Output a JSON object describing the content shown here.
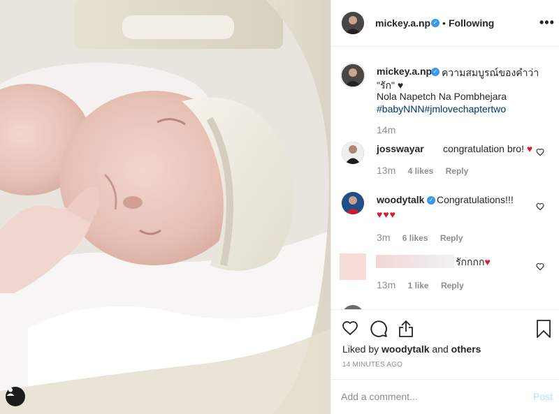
{
  "post": {
    "username": "mickey.a.np",
    "follow_status": "Following",
    "more_label": "•••",
    "separator": "•"
  },
  "caption": {
    "username": "mickey.a.np",
    "line1": "ความสมบูรณ์ของคำว่า",
    "line2": "\"รัก\" ♥",
    "line3": "Nola Napetch Na Pombhejara",
    "hashtags": "#babyNNN#jmlovechaptertwo",
    "time": "14m"
  },
  "comments": [
    {
      "username": "josswayar",
      "text": "congratulation bro!",
      "emoji": "♥",
      "time": "13m",
      "likes": "4 likes",
      "reply": "Reply",
      "verified": false
    },
    {
      "username": "woodytalk",
      "text": "Congratulations!!!",
      "emoji": "♥♥♥",
      "time": "3m",
      "likes": "6 likes",
      "reply": "Reply",
      "verified": true
    },
    {
      "username": "",
      "text": "รักกกก",
      "emoji": "♥",
      "time": "13m",
      "likes": "1 like",
      "reply": "Reply",
      "verified": false
    }
  ],
  "actions": {
    "liked_by_prefix": "Liked by",
    "liked_by_user": "woodytalk",
    "liked_by_and": "and",
    "liked_by_others": "others",
    "timestamp": "14 MINUTES AGO"
  },
  "comment_box": {
    "placeholder": "Add a comment...",
    "post_label": "Post"
  },
  "icons": {
    "verified": "verified-badge-icon",
    "like": "heart-outline-icon",
    "comment": "speech-bubble-icon",
    "share": "share-upload-icon",
    "save": "bookmark-icon",
    "user_tag": "person-icon"
  },
  "colors": {
    "verified_blue": "#3897f0",
    "hashtag_blue": "#003569",
    "heart_red": "#e0192f",
    "muted_text": "#8e8e8e",
    "post_disabled": "#b2dffc"
  }
}
